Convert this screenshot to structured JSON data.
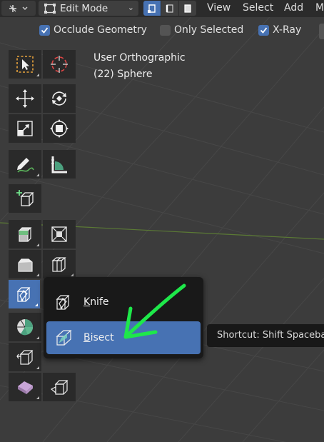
{
  "header": {
    "mode": "Edit Mode",
    "menus": [
      "View",
      "Select",
      "Add",
      "M"
    ]
  },
  "overlay": {
    "options": [
      {
        "label": "Occlude Geometry",
        "checked": true
      },
      {
        "label": "Only Selected",
        "checked": false
      },
      {
        "label": "X-Ray",
        "checked": true
      }
    ]
  },
  "viewport": {
    "view_name": "User Orthographic",
    "object_name": "(22) Sphere"
  },
  "toolbar": {
    "icons": [
      "select-box-icon",
      "cursor-icon",
      "move-icon",
      "rotate-icon",
      "scale-icon",
      "transform-icon",
      "annotate-icon",
      "measure-icon",
      "add-cube-icon",
      "extrude-region-icon",
      "inset-faces-icon",
      "bevel-icon",
      "loop-cut-icon",
      "knife-icon",
      "poly-build-icon",
      "spin-icon",
      "smooth-icon",
      "edge-slide-icon",
      "shrink-fatten-icon",
      "shear-icon",
      "rip-region-icon"
    ]
  },
  "popup": {
    "items": [
      {
        "label": "Knife",
        "underline": "K",
        "rest": "nife",
        "icon": "knife-icon"
      },
      {
        "label": "Bisect",
        "underline": "B",
        "rest": "isect",
        "icon": "bisect-icon",
        "highlighted": true
      }
    ]
  },
  "tooltip": {
    "text": "Shortcut: Shift Spacebar"
  },
  "colors": {
    "accent": "#4772b3",
    "annotation": "#1ee84a",
    "viewport_bg": "#3c3c3c",
    "header_bg": "#2b2b2b"
  }
}
